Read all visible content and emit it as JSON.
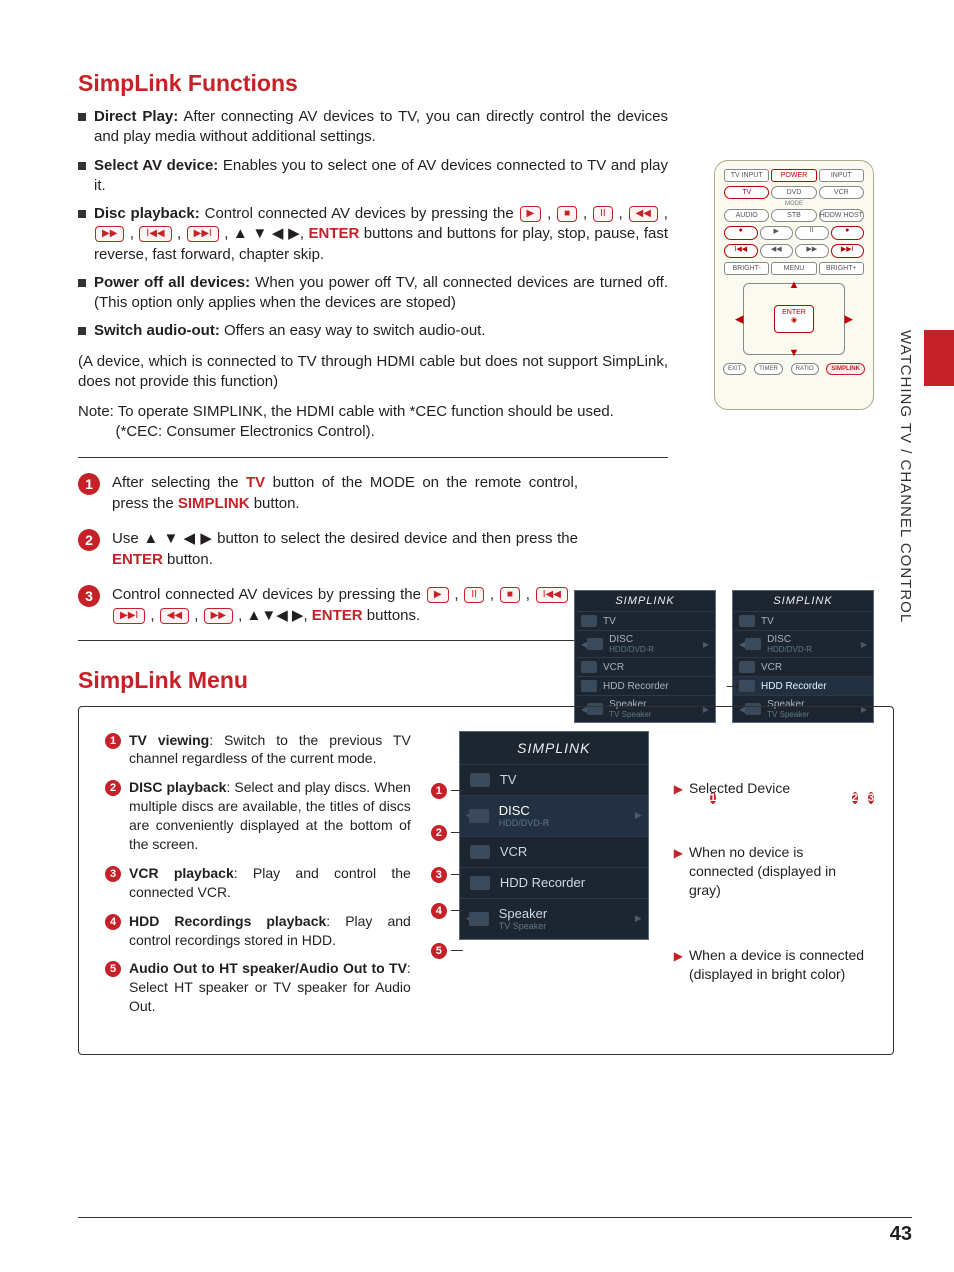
{
  "sideTab": "WATCHING TV / CHANNEL CONTROL",
  "pageNumber": "43",
  "section1": {
    "title": "SimpLink Functions",
    "bullets": [
      {
        "label": "Direct Play:",
        "text": "After connecting AV devices to TV, you can directly control the devices and play media without additional settings."
      },
      {
        "label": "Select AV device:",
        "text": "Enables you to select one of AV devices connected to TV and play it."
      },
      {
        "label": "Disc playback:",
        "text1": "Control connected AV devices by pressing the ",
        "text2": " buttons and buttons for play, stop, pause, fast reverse, fast forward, chapter skip."
      },
      {
        "label": "Power off all devices:",
        "text": "When you power off TV, all connected devices are turned off.(This option only applies when the devices are stoped)"
      },
      {
        "label": "Switch audio-out:",
        "text": "Offers an easy way to switch audio-out."
      }
    ],
    "para1": "(A device, which is connected to TV through HDMI cable but does not support SimpLink, does not provide this function)",
    "para2a": "Note: To operate SIMPLINK, the HDMI cable with *CEC function should be used.",
    "para2b": "(*CEC: Consumer Electronics Control)."
  },
  "remote": {
    "row1": [
      "TV INPUT",
      "POWER",
      "INPUT"
    ],
    "row2": [
      "TV",
      "DVD",
      "VCR"
    ],
    "row2sub": "MODE",
    "row3": [
      "AUDIO",
      "STB",
      "HDDW HOST"
    ],
    "row4": [
      "●",
      "▶",
      "II",
      "●"
    ],
    "row5": [
      "I◀◀",
      "◀◀",
      "▶▶",
      "▶▶I"
    ],
    "row6": [
      "BRIGHT-",
      "MENU",
      "BRIGHT+"
    ],
    "enter": "ENTER",
    "low": [
      "EXIT",
      "TIMER",
      "RATIO",
      "SIMPLINK"
    ]
  },
  "steps": [
    {
      "n": "1",
      "t1": "After selecting the ",
      "k1": "TV",
      "t2": " button of the MODE on the remote control, press the ",
      "k2": "SIMPLINK",
      "t3": " button."
    },
    {
      "n": "2",
      "t1": "Use ",
      "sym": "▲ ▼ ◀ ▶",
      "t2": " button to select the desired device and then press the ",
      "k1": "ENTER",
      "t3": " button."
    },
    {
      "n": "3",
      "t1": "Control connected AV devices by pressing the ",
      "t2": " buttons.",
      "k1": "ENTER",
      "sym": "▲▼◀ ▶"
    }
  ],
  "miniScreen": {
    "title": "SIMPLINK",
    "rows": [
      {
        "l1": "TV",
        "l2": ""
      },
      {
        "l1": "DISC",
        "l2": "HDD/DVD-R"
      },
      {
        "l1": "VCR",
        "l2": ""
      },
      {
        "l1": "HDD Recorder",
        "l2": ""
      },
      {
        "l1": "Speaker",
        "l2": "TV Speaker"
      }
    ]
  },
  "miniNums": [
    "1",
    "2",
    "3"
  ],
  "section2": {
    "title": "SimpLink Menu",
    "items": [
      {
        "n": "1",
        "label": "TV viewing",
        "text": ": Switch to the previous TV channel regardless of the current mode."
      },
      {
        "n": "2",
        "label": "DISC playback",
        "text": ": Select and play discs. When multiple discs are available, the titles of discs are conveniently displayed at the bottom of the screen."
      },
      {
        "n": "3",
        "label": "VCR playback",
        "text": ": Play and control the connected VCR."
      },
      {
        "n": "4",
        "label": "HDD Recordings playback",
        "text": ": Play and control recordings stored in HDD."
      },
      {
        "n": "5",
        "label": "Audio Out to HT speaker/Audio Out to TV",
        "text": ": Select HT speaker or TV speaker for Audio Out."
      }
    ],
    "right": [
      "Selected Device",
      "When no device is connected (displayed in gray)",
      "When a device is connected (displayed in bright color)"
    ]
  },
  "inlineButtons": {
    "play": "▶",
    "stop": "■",
    "pause": "II",
    "rew": "◀◀",
    "ff": "▶▶",
    "prev": "I◀◀",
    "next": "▶▶I",
    "enter": "ENTER",
    "arrows": "▲ ▼ ◀ ▶"
  }
}
